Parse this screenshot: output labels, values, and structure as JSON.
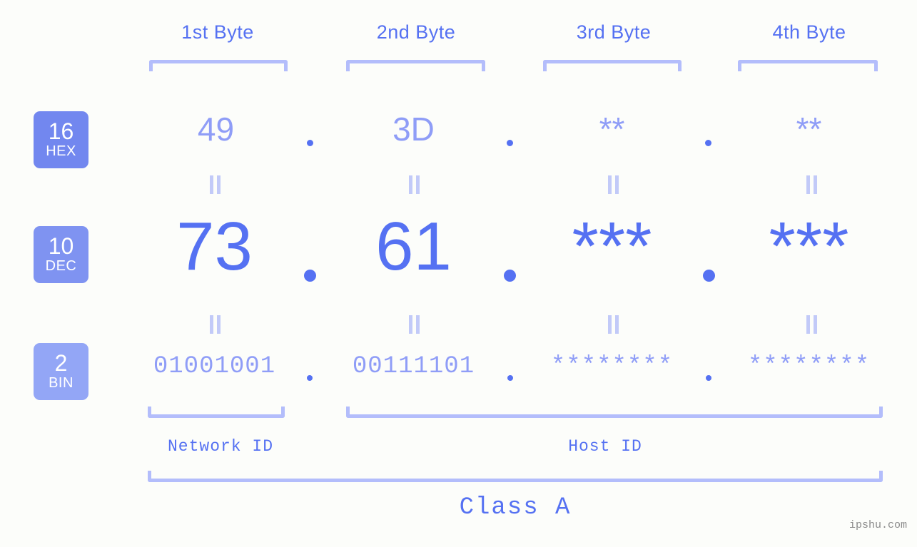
{
  "background_color": "#fcfdfa",
  "accent_colors": {
    "primary": "#5571f2",
    "muted": "#8f9df7",
    "bracket": "#b3bdfb",
    "connector": "#c2caf8",
    "badge_hex": "#7287ef",
    "badge_dec": "#7f93f1",
    "badge_bin": "#93a6f6",
    "watermark": "#8a8a8a"
  },
  "byte_headers": [
    {
      "label": "1st Byte"
    },
    {
      "label": "2nd Byte"
    },
    {
      "label": "3rd Byte"
    },
    {
      "label": "4th Byte"
    }
  ],
  "bases": [
    {
      "number": "16",
      "name": "HEX"
    },
    {
      "number": "10",
      "name": "DEC"
    },
    {
      "number": "2",
      "name": "BIN"
    }
  ],
  "rows": {
    "hex": {
      "base_number": "16",
      "base_name": "HEX",
      "values": [
        "49",
        "3D",
        "**",
        "**"
      ],
      "separator": "."
    },
    "dec": {
      "base_number": "10",
      "base_name": "DEC",
      "values": [
        "73",
        "61",
        "***",
        "***"
      ],
      "separator": "."
    },
    "bin": {
      "base_number": "2",
      "base_name": "BIN",
      "values": [
        "01001001",
        "00111101",
        "********",
        "********"
      ],
      "separator": "."
    }
  },
  "segments": {
    "network_id": "Network ID",
    "host_id": "Host ID",
    "class": "Class A"
  },
  "watermark": "ipshu.com"
}
